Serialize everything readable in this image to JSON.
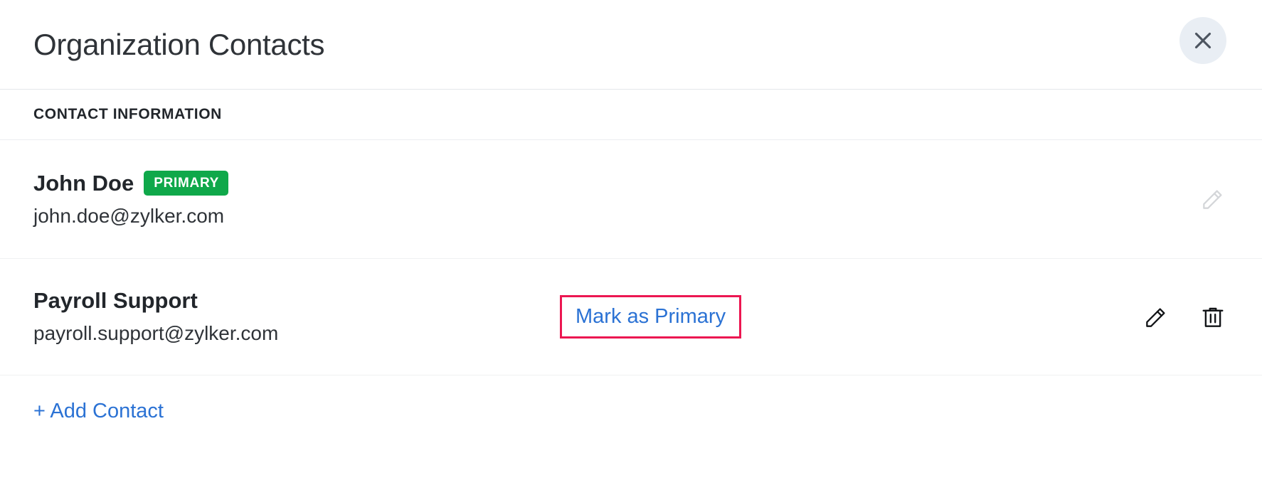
{
  "header": {
    "title": "Organization Contacts",
    "close_icon": "close-icon"
  },
  "section": {
    "label": "CONTACT INFORMATION"
  },
  "contacts": [
    {
      "name": "John Doe",
      "badge": "PRIMARY",
      "email": "john.doe@zylker.com",
      "edit_icon": "pencil-icon",
      "has_delete": false,
      "has_mark_primary": false
    },
    {
      "name": "Payroll Support",
      "badge": null,
      "email": "payroll.support@zylker.com",
      "mark_primary_label": "Mark as Primary",
      "edit_icon": "pencil-icon",
      "delete_icon": "trash-icon",
      "has_delete": true,
      "has_mark_primary": true
    }
  ],
  "footer": {
    "add_contact_label": "+ Add Contact"
  },
  "colors": {
    "badge_green": "#0fa84a",
    "link_blue": "#2b72d4",
    "highlight_pink": "#ec1651",
    "close_bg": "#e9eef4",
    "text_dark": "#22262b",
    "divider": "#eceef0"
  }
}
